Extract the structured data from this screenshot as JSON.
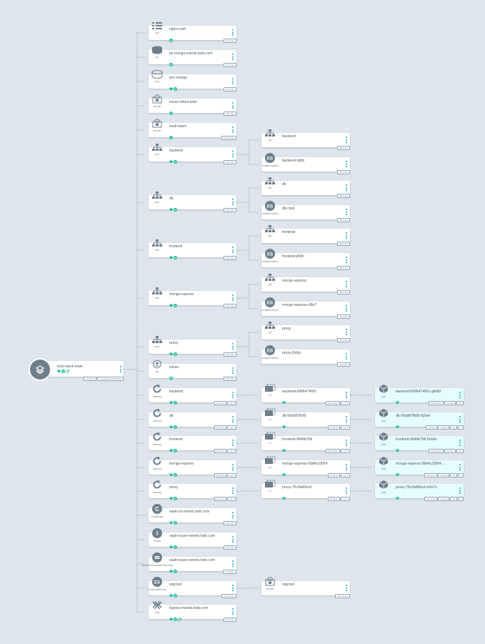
{
  "root": {
    "name": "todo-stack-main",
    "health": [
      "healthy",
      "synced",
      "external-link"
    ],
    "tags": [
      "79 hours",
      "1 parameter overridden"
    ]
  },
  "resources": [
    {
      "id": "nginx",
      "kind": "cm",
      "name": "nginx.conf",
      "status": [
        "synced"
      ],
      "tags": [
        "79 hours"
      ],
      "icon": "configmap-icon"
    },
    {
      "id": "pv",
      "kind": "pv",
      "name": "pv-mongo-events.todo.com",
      "status": [
        "synced"
      ],
      "tags": [
        "77 hours"
      ],
      "icon": "pv-icon"
    },
    {
      "id": "pvc",
      "kind": "pvc",
      "name": "pvc-mongo",
      "status": [
        "healthy",
        "synced"
      ],
      "tags": [
        "77 hours"
      ],
      "icon": "pvc-icon"
    },
    {
      "id": "issuertoken",
      "kind": "secret",
      "name": "issuer-token-todo",
      "status": [
        "synced"
      ],
      "tags": [
        "79 hours"
      ],
      "icon": "secret-icon"
    },
    {
      "id": "vaulttoken",
      "kind": "secret",
      "name": "vault-token",
      "status": [
        "synced"
      ],
      "tags": [
        "25 minutes"
      ],
      "icon": "secret-icon"
    },
    {
      "id": "svc-backend",
      "kind": "svc",
      "name": "backend",
      "status": [
        "healthy",
        "synced"
      ],
      "tags": [
        "79 hours"
      ],
      "icon": "service-icon"
    },
    {
      "id": "svc-db",
      "kind": "svc",
      "name": "db",
      "status": [
        "healthy",
        "synced"
      ],
      "tags": [
        "79 hours"
      ],
      "icon": "service-icon"
    },
    {
      "id": "svc-frontend",
      "kind": "svc",
      "name": "frontend",
      "status": [
        "healthy",
        "synced"
      ],
      "tags": [
        "79 hours"
      ],
      "icon": "service-icon"
    },
    {
      "id": "svc-mongo",
      "kind": "svc",
      "name": "mongo-express",
      "status": [
        "healthy",
        "synced"
      ],
      "tags": [
        "79 hours"
      ],
      "icon": "service-icon"
    },
    {
      "id": "svc-proxy",
      "kind": "svc",
      "name": "proxy",
      "status": [
        "healthy",
        "synced"
      ],
      "tags": [
        "79 hours"
      ],
      "icon": "service-icon"
    },
    {
      "id": "sa-issuer",
      "kind": "sa",
      "name": "issuer",
      "status": [
        "synced"
      ],
      "tags": [
        "79 hours"
      ],
      "icon": "serviceaccount-icon"
    },
    {
      "id": "deploy-backend",
      "kind": "deploy",
      "name": "backend",
      "status": [
        "healthy",
        "synced"
      ],
      "tags": [
        "79 hours",
        "rev:3"
      ],
      "icon": "deployment-icon"
    },
    {
      "id": "deploy-db",
      "kind": "deploy",
      "name": "db",
      "status": [
        "healthy",
        "synced"
      ],
      "tags": [
        "79 hours",
        "rev:1"
      ],
      "icon": "deployment-icon"
    },
    {
      "id": "deploy-frontend",
      "kind": "deploy",
      "name": "frontend",
      "status": [
        "healthy",
        "synced"
      ],
      "tags": [
        "79 hours",
        "rev:3"
      ],
      "icon": "deployment-icon"
    },
    {
      "id": "deploy-mongo",
      "kind": "deploy",
      "name": "mongo-express",
      "status": [
        "healthy",
        "synced"
      ],
      "tags": [
        "79 hours",
        "rev:1"
      ],
      "icon": "deployment-icon"
    },
    {
      "id": "deploy-proxy",
      "kind": "deploy",
      "name": "proxy",
      "status": [
        "healthy",
        "synced"
      ],
      "tags": [
        "79 hours",
        "rev:1"
      ],
      "icon": "deployment-icon"
    },
    {
      "id": "cert",
      "kind": "certificate",
      "name": "vault-crt-events.todo.com",
      "status": [
        "healthy",
        "synced"
      ],
      "tags": [
        "79 hours"
      ],
      "icon": "certificate-icon"
    },
    {
      "id": "issuer",
      "kind": "issuer",
      "name": "vault-issuer-events.todo.com",
      "status": [
        "healthy",
        "synced"
      ],
      "tags": [
        "79 hours"
      ],
      "icon": "issuer-icon"
    },
    {
      "id": "cissuer",
      "kind": "clusterissuersecurecomp",
      "name": "vault-issuer-events.todo.com",
      "status": [
        "healthy",
        "synced"
      ],
      "tags": [
        "6 minutes"
      ],
      "icon": "clusterissuer-icon"
    },
    {
      "id": "regcred",
      "kind": "externalsecret",
      "name": "regcred",
      "status": [
        "healthy",
        "synced"
      ],
      "tags": [
        "26 minutes"
      ],
      "icon": "externalsecret-icon"
    },
    {
      "id": "ing",
      "kind": "ing",
      "name": "ingress-events.todo.com",
      "status": [
        "healthy",
        "synced",
        "external-link"
      ],
      "tags": [
        "79 hours"
      ],
      "icon": "ingress-icon"
    }
  ],
  "children": [
    {
      "id": "ep-backend",
      "parent": "svc-backend",
      "kind": "ep",
      "name": "backend",
      "status": [],
      "tags": [
        "79 hours"
      ],
      "icon": "endpoint-icon"
    },
    {
      "id": "es-backend",
      "parent": "svc-backend",
      "kind": "endpointslice",
      "name": "backend-hjbht",
      "status": [],
      "tags": [
        "79 hours"
      ],
      "icon": "endpointslice-icon"
    },
    {
      "id": "ep-db",
      "parent": "svc-db",
      "kind": "ep",
      "name": "db",
      "status": [],
      "tags": [
        "79 hours"
      ],
      "icon": "endpoint-icon"
    },
    {
      "id": "es-db",
      "parent": "svc-db",
      "kind": "endpointslice",
      "name": "db-crjvk",
      "status": [],
      "tags": [
        "79 hours"
      ],
      "icon": "endpointslice-icon"
    },
    {
      "id": "ep-frontend",
      "parent": "svc-frontend",
      "kind": "ep",
      "name": "frontend",
      "status": [],
      "tags": [
        "79 hours"
      ],
      "icon": "endpoint-icon"
    },
    {
      "id": "es-frontend",
      "parent": "svc-frontend",
      "kind": "endpointslice",
      "name": "frontend-j696r",
      "status": [],
      "tags": [
        "79 hours"
      ],
      "icon": "endpointslice-icon"
    },
    {
      "id": "ep-mongo",
      "parent": "svc-mongo",
      "kind": "ep",
      "name": "mongo-express",
      "status": [],
      "tags": [
        "79 hours"
      ],
      "icon": "endpoint-icon"
    },
    {
      "id": "es-mongo",
      "parent": "svc-mongo",
      "kind": "endpointslice",
      "name": "mongo-express-z9br7",
      "status": [],
      "tags": [
        "79 hours"
      ],
      "icon": "endpointslice-icon"
    },
    {
      "id": "ep-proxy",
      "parent": "svc-proxy",
      "kind": "ep",
      "name": "proxy",
      "status": [],
      "tags": [
        "79 hours"
      ],
      "icon": "endpoint-icon"
    },
    {
      "id": "es-proxy",
      "parent": "svc-proxy",
      "kind": "endpointslice",
      "name": "proxy-j9x6p",
      "status": [],
      "tags": [
        "79 hours"
      ],
      "icon": "endpointslice-icon"
    },
    {
      "id": "rs-backend",
      "parent": "deploy-backend",
      "kind": "rs",
      "name": "backend-698647495c",
      "status": [
        "healthy"
      ],
      "tags": [
        "26 minutes",
        "rev:3"
      ],
      "icon": "replicaset-icon"
    },
    {
      "id": "rs-db",
      "parent": "deploy-db",
      "kind": "rs",
      "name": "db-56dd87fb85",
      "status": [
        "healthy"
      ],
      "tags": [
        "79 hours",
        "rev:1"
      ],
      "icon": "replicaset-icon"
    },
    {
      "id": "rs-frontend",
      "parent": "deploy-frontend",
      "kind": "rs",
      "name": "frontend-9fdf4b768",
      "status": [
        "healthy"
      ],
      "tags": [
        "26 minutes",
        "rev:3"
      ],
      "icon": "replicaset-icon"
    },
    {
      "id": "rs-mongo",
      "parent": "deploy-mongo",
      "kind": "rs",
      "name": "mongo-express-58d4cc5854",
      "status": [
        "healthy"
      ],
      "tags": [
        "79 hours",
        "rev:1"
      ],
      "icon": "replicaset-icon"
    },
    {
      "id": "rs-proxy",
      "parent": "deploy-proxy",
      "kind": "rs",
      "name": "proxy-75c5bd9bcd",
      "status": [
        "healthy"
      ],
      "tags": [
        "79 hours",
        "rev:1"
      ],
      "icon": "replicaset-icon"
    },
    {
      "id": "secret-regcred",
      "parent": "regcred",
      "kind": "secret",
      "name": "regcred",
      "status": [],
      "tags": [
        "26 minutes"
      ],
      "icon": "secret-icon"
    }
  ],
  "pods": [
    {
      "id": "pod-backend",
      "parent": "rs-backend",
      "kind": "pod",
      "name": "backend-698647495c-gkk8d",
      "status": [
        "healthy"
      ],
      "tags": [
        "26 minutes",
        "running",
        "1/1"
      ],
      "icon": "pod-icon"
    },
    {
      "id": "pod-db",
      "parent": "rs-db",
      "kind": "pod",
      "name": "db-56dd87fb85-6j2wk",
      "status": [
        "healthy"
      ],
      "tags": [
        "7 hours",
        "running",
        "1/1",
        "0"
      ],
      "icon": "pod-icon"
    },
    {
      "id": "pod-frontend",
      "parent": "rs-frontend",
      "kind": "pod",
      "name": "frontend-9fdf4b768-5nh8n",
      "status": [
        "healthy"
      ],
      "tags": [
        "26 minutes",
        "running",
        "1/1"
      ],
      "icon": "pod-icon"
    },
    {
      "id": "pod-mongo",
      "parent": "rs-mongo",
      "kind": "pod",
      "name": "mongo-express-58d4cc5854-...",
      "status": [
        "healthy"
      ],
      "tags": [
        "79 hours",
        "running",
        "1/1",
        "0"
      ],
      "icon": "pod-icon"
    },
    {
      "id": "pod-proxy",
      "parent": "rs-proxy",
      "kind": "pod",
      "name": "proxy-75c5bd9bcd-m6x7n",
      "status": [
        "healthy"
      ],
      "tags": [
        "79 hours",
        "running",
        "1/1",
        "0"
      ],
      "icon": "pod-icon"
    }
  ],
  "colors": {
    "healthy": "#18be94",
    "synced": "#18be94",
    "icon": "#6d7f8b",
    "menu": "#0dadea",
    "edge": "#8fa4b1",
    "background": "#dee5ec"
  }
}
